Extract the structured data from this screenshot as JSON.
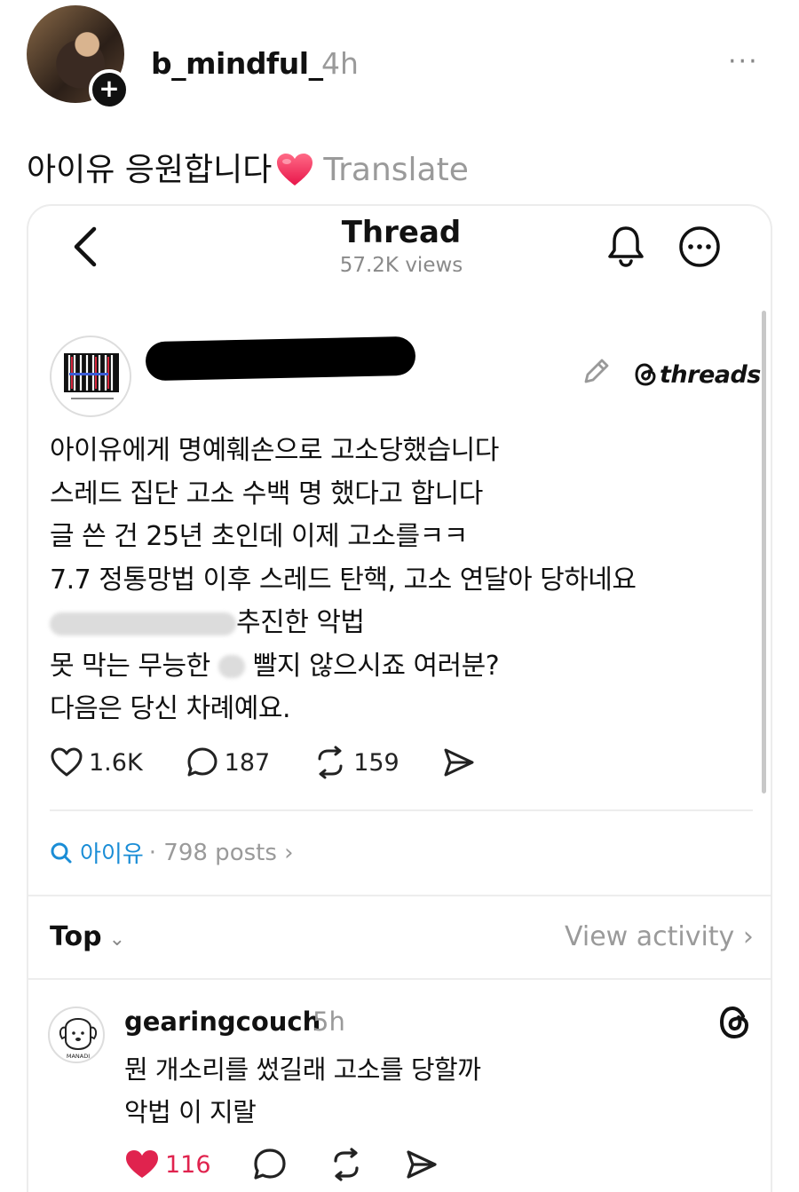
{
  "outer": {
    "username": "b_mindful_",
    "time": "4h",
    "caption": "아이유 응원합니다",
    "translate": "Translate",
    "more": "···"
  },
  "embedded": {
    "title": "Thread",
    "views": "57.2K views",
    "brand": "threads",
    "body_lines": [
      "아이유에게 명예훼손으로 고소당했습니다",
      "스레드 집단 고소 수백 명 했다고 합니다",
      "글 쓴 건 25년 초인데 이제 고소를ㅋㅋ",
      "7.7 정통망법 이후 스레드 탄핵, 고소 연달아 당하네요",
      "추진한 악법",
      "못 막는 무능한",
      "빨지 않으시죠 여러분?",
      "다음은 당신 차례예요."
    ],
    "counts": {
      "likes": "1.6K",
      "comments": "187",
      "reposts": "159"
    },
    "search": {
      "tag": "아이유",
      "posts": "· 798 posts ›"
    },
    "sort": {
      "label": "Top",
      "chevron": "⌄",
      "view_activity": "View activity  ›"
    },
    "reply": {
      "username": "gearingcouch",
      "time": "5h",
      "lines": [
        "뭔 개소리를 썼길래 고소를 당할까",
        "악법 이 지랄"
      ],
      "likes": "116",
      "avatar_text": "MANADI"
    }
  },
  "colors": {
    "accent_blue": "#1a8dd6",
    "like_red": "#e0234e",
    "muted": "#9a9a9a"
  }
}
